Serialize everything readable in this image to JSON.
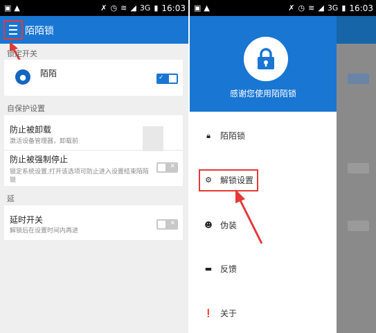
{
  "status_bar": {
    "time": "16:03",
    "network": "3G"
  },
  "left_screen": {
    "app_title": "陌陌锁",
    "sections": {
      "lock_switch": {
        "header": "锁定开关",
        "app_name": "陌陌"
      },
      "self_protect": {
        "header": "自保护设置",
        "prevent_uninstall": {
          "title": "防止被卸载",
          "subtitle": "激活设备管理器，卸载前"
        },
        "prevent_force_stop": {
          "title": "防止被强制停止",
          "subtitle": "锁定系统设置,打开该选项可防止进入设置结束陌陌锁"
        }
      },
      "other": {
        "header": "延",
        "delay_switch": {
          "title": "延时开关",
          "subtitle": "解锁后在设置时间内再进"
        }
      }
    }
  },
  "right_screen": {
    "drawer_thanks": "感谢您使用陌陌锁",
    "menu_items": [
      {
        "label": "陌陌锁",
        "icon": "lock-icon"
      },
      {
        "label": "解锁设置",
        "icon": "gear-icon"
      },
      {
        "label": "伪装",
        "icon": "mask-icon"
      },
      {
        "label": "反馈",
        "icon": "chat-icon"
      },
      {
        "label": "关于",
        "icon": "info-icon"
      }
    ]
  },
  "colors": {
    "primary": "#1976d2",
    "highlight": "#e53935",
    "toggle_off": "#c8c8c8"
  }
}
